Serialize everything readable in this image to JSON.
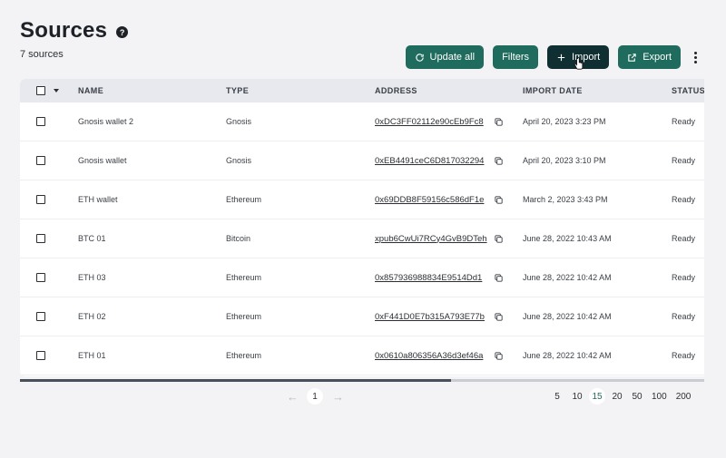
{
  "header": {
    "title": "Sources",
    "help": "?",
    "count": "7 sources"
  },
  "toolbar": {
    "update_all": "Update all",
    "filters": "Filters",
    "import": "Import",
    "export": "Export"
  },
  "table": {
    "columns": {
      "name": "NAME",
      "type": "TYPE",
      "address": "ADDRESS",
      "import_date": "IMPORT DATE",
      "status": "STATUS"
    },
    "rows": [
      {
        "name": "Gnosis wallet 2",
        "type": "Gnosis",
        "address": "0xDC3FF02112e90cEb9Fc8",
        "date": "April 20, 2023 3:23 PM",
        "status": "Ready"
      },
      {
        "name": "Gnosis wallet",
        "type": "Gnosis",
        "address": "0xEB4491ceC6D817032294",
        "date": "April 20, 2023 3:10 PM",
        "status": "Ready"
      },
      {
        "name": "ETH wallet",
        "type": "Ethereum",
        "address": "0x69DDB8F59156c586dF1e",
        "date": "March 2, 2023 3:43 PM",
        "status": "Ready"
      },
      {
        "name": "BTC 01",
        "type": "Bitcoin",
        "address": "xpub6CwUi7RCy4GvB9DTeh",
        "date": "June 28, 2022 10:43 AM",
        "status": "Ready"
      },
      {
        "name": "ETH 03",
        "type": "Ethereum",
        "address": "0x857936988834E9514Dd1",
        "date": "June 28, 2022 10:42 AM",
        "status": "Ready"
      },
      {
        "name": "ETH 02",
        "type": "Ethereum",
        "address": "0xF441D0E7b315A793E77b",
        "date": "June 28, 2022 10:42 AM",
        "status": "Ready"
      },
      {
        "name": "ETH 01",
        "type": "Ethereum",
        "address": "0x0610a806356A36d3ef46a",
        "date": "June 28, 2022 10:42 AM",
        "status": "Ready"
      }
    ]
  },
  "pagination": {
    "current_page": "1",
    "page_sizes": [
      "5",
      "10",
      "15",
      "20",
      "50",
      "100",
      "200"
    ],
    "selected_size": "15"
  },
  "colors": {
    "primary": "#1f6b5d",
    "dark_button": "#0f2f33",
    "background": "#f3f3f5"
  },
  "scrollbar": {
    "scroll_position": 0.63
  }
}
